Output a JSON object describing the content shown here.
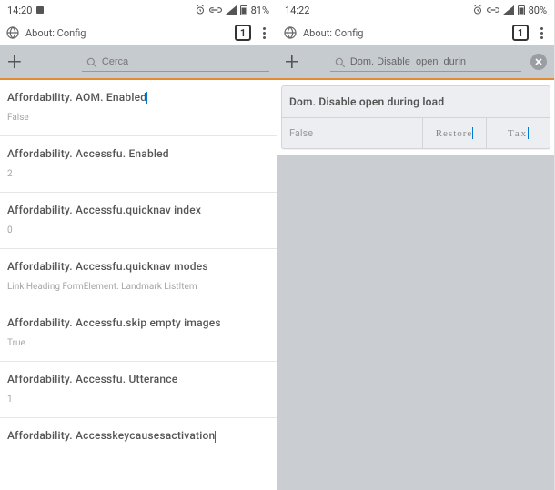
{
  "left": {
    "status": {
      "time": "14:20",
      "battery": "81%"
    },
    "url": "About: Config",
    "tab_count": "1",
    "search_placeholder": "Cerca",
    "prefs": [
      {
        "key": "Affordability. AOM. Enabled",
        "val": "False"
      },
      {
        "key": "Affordability. Accessfu. Enabled",
        "val": "2"
      },
      {
        "key": "Affordability. Accessfu.quicknav  index",
        "val": "0"
      },
      {
        "key": "Affordability. Accessfu.quicknav  modes",
        "val": "Link Heading FormElement. Landmark ListItem"
      },
      {
        "key": "Affordability. Accessfu.skip  empty  images",
        "val": "True."
      },
      {
        "key": "Affordability. Accessfu. Utterance",
        "val": "1"
      },
      {
        "key": "Affordability. Accesskeycausesactivation",
        "val": ""
      }
    ]
  },
  "right": {
    "status": {
      "time": "14:22",
      "battery": "80%"
    },
    "url": "About: Config",
    "tab_count": "1",
    "search_value": "Dom. Disable  open  durin",
    "result": {
      "key": "Dom. Disable  open  during load",
      "val": "False",
      "btn1": "Restore",
      "btn2": "Tax"
    }
  }
}
